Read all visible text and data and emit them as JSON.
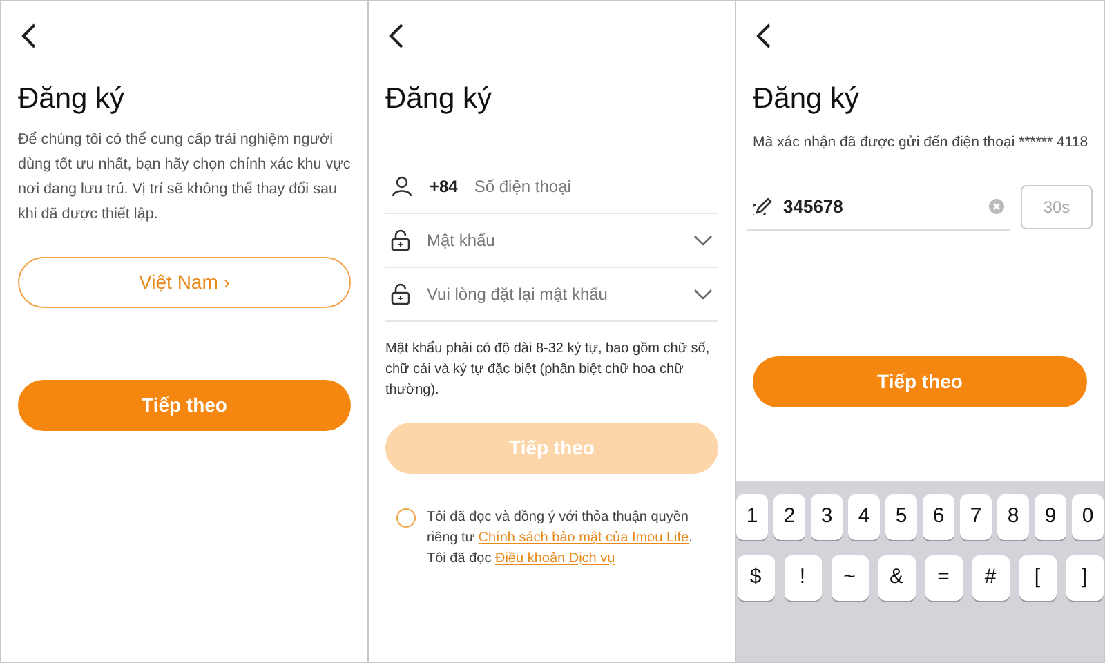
{
  "region_screen": {
    "title": "Đăng ký",
    "description": "Để chúng tôi có thể cung cấp trải nghiệm người dùng tốt ưu nhất, bạn hãy chọn chính xác khu vực nơi đang lưu trú. Vị trí sẽ không thể thay đổi sau khi đã được thiết lập.",
    "region_button": "Việt Nam ›",
    "next_button": {
      "label": "Tiếp theo",
      "disabled": false
    }
  },
  "password_screen": {
    "title": "Đăng ký",
    "fields": [
      {
        "kind": "phone",
        "prefix": "+84",
        "placeholder": "Số điện thoại"
      },
      {
        "kind": "password",
        "placeholder": "Mật khẩu"
      },
      {
        "kind": "password",
        "placeholder": "Vui lòng đặt lại mật khẩu"
      }
    ],
    "hint": "Mật khẩu phải có độ dài 8-32 ký tự, bao gồm chữ số, chữ cái và ký tự đặc biệt (phân biệt chữ hoa chữ thường).",
    "next_button": {
      "label": "Tiếp theo",
      "disabled": true
    },
    "consent": {
      "checked": false,
      "parts": [
        {
          "kind": "text",
          "text": "Tôi đã đọc và đồng ý với thỏa thuận quyền riêng tư "
        },
        {
          "kind": "link",
          "text": "Chính sách bảo mật của Imou Life"
        },
        {
          "kind": "text",
          "text": ". Tôi đã đọc "
        },
        {
          "kind": "link",
          "text": "Điều khoản Dịch vụ"
        }
      ]
    }
  },
  "code_screen": {
    "title": "Đăng ký",
    "message": "Mã xác nhận đã được gửi đến điện thoại ****** 4118",
    "code": "345678",
    "resend_button": "30s",
    "next_button": {
      "label": "Tiếp theo",
      "disabled": false
    },
    "keyboard": [
      [
        "1",
        "2",
        "3",
        "4",
        "5",
        "6",
        "7",
        "8",
        "9",
        "0"
      ],
      [
        "$",
        "!",
        "~",
        "&",
        "=",
        "#",
        "[",
        "]"
      ]
    ]
  }
}
